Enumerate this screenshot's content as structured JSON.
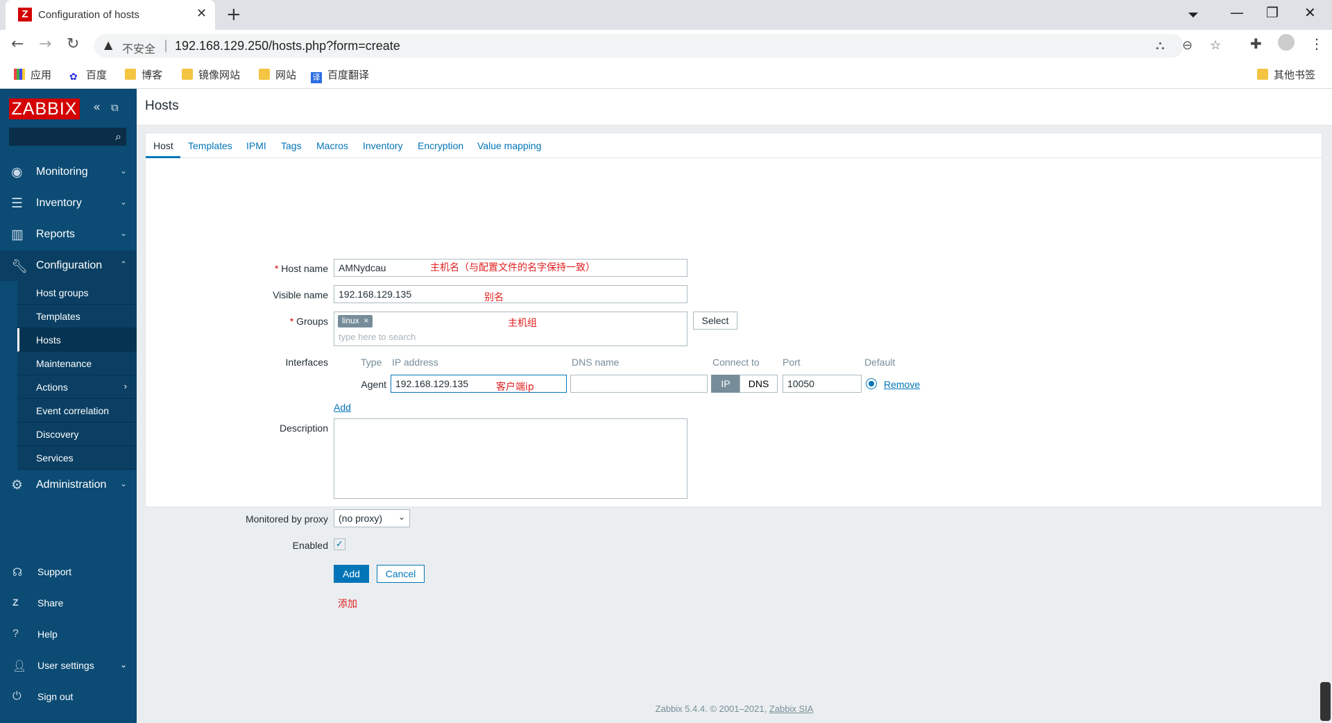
{
  "browser": {
    "tab_title": "Configuration of hosts",
    "tab_favicon": "Z",
    "insecure_label": "不安全",
    "url": "192.168.129.250/hosts.php?form=create",
    "bookmarks": [
      "应用",
      "百度",
      "博客",
      "镜像网站",
      "网站",
      "百度翻译"
    ],
    "other_bookmarks": "其他书签"
  },
  "sidebar": {
    "logo": "ZABBIX",
    "menu": [
      {
        "label": "Monitoring",
        "icon": "eye-icon"
      },
      {
        "label": "Inventory",
        "icon": "list-icon"
      },
      {
        "label": "Reports",
        "icon": "chart-icon"
      },
      {
        "label": "Configuration",
        "icon": "wrench-icon"
      }
    ],
    "config_sub": [
      "Host groups",
      "Templates",
      "Hosts",
      "Maintenance",
      "Actions",
      "Event correlation",
      "Discovery",
      "Services"
    ],
    "admin": "Administration",
    "bottom": [
      "Support",
      "Share",
      "Help",
      "User settings",
      "Sign out"
    ]
  },
  "page": {
    "title": "Hosts",
    "tabs": [
      "Host",
      "Templates",
      "IPMI",
      "Tags",
      "Macros",
      "Inventory",
      "Encryption",
      "Value mapping"
    ]
  },
  "form": {
    "host_name_label": "Host name",
    "host_name_value": "AMNydcau",
    "host_name_note": "主机名（与配置文件的名字保持一致）",
    "visible_name_label": "Visible name",
    "visible_name_value": "192.168.129.135",
    "visible_name_note": "别名",
    "groups_label": "Groups",
    "group_tag": "linux",
    "groups_placeholder": "type here to search",
    "groups_note": "主机组",
    "select_button": "Select",
    "interfaces_label": "Interfaces",
    "iface_headers": {
      "type": "Type",
      "ip": "IP address",
      "dns": "DNS name",
      "connect": "Connect to",
      "port": "Port",
      "default": "Default"
    },
    "iface_type": "Agent",
    "iface_ip": "192.168.129.135",
    "iface_ip_note": "客户端ip",
    "iface_dns": "",
    "connect_ip": "IP",
    "connect_dns": "DNS",
    "iface_port": "10050",
    "remove_link": "Remove",
    "add_link": "Add",
    "description_label": "Description",
    "proxy_label": "Monitored by proxy",
    "proxy_value": "(no proxy)",
    "enabled_label": "Enabled",
    "add_button": "Add",
    "cancel_button": "Cancel",
    "add_note": "添加"
  },
  "footer": {
    "text": "Zabbix 5.4.4. © 2001–2021, ",
    "link": "Zabbix SIA"
  }
}
